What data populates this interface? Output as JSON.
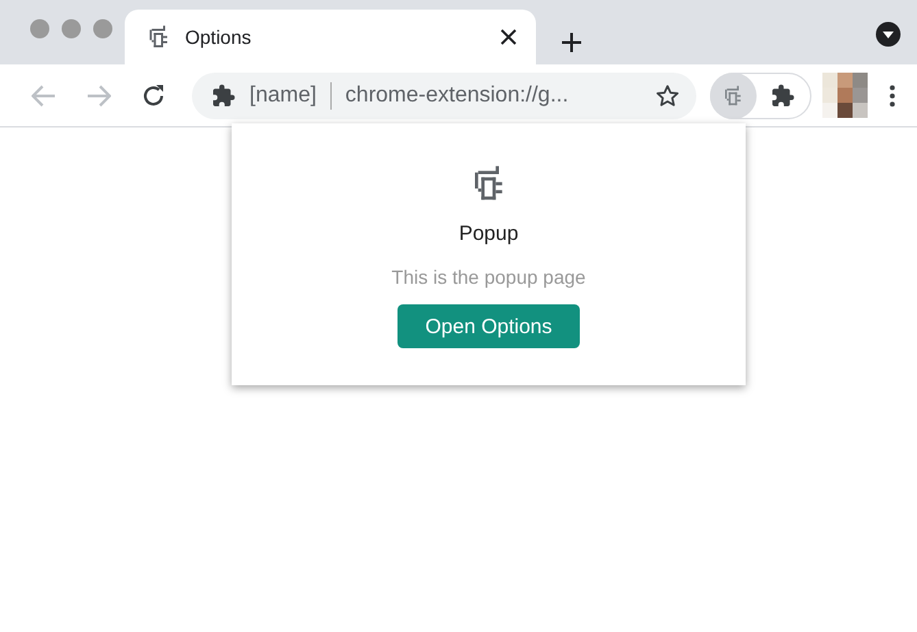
{
  "tab": {
    "title": "Options",
    "selected": true
  },
  "omnibox": {
    "site_name": "[name]",
    "url": "chrome-extension://g..."
  },
  "toolbar": {
    "extension_active": true
  },
  "popup": {
    "title": "Popup",
    "description": "This is the popup page",
    "button": "Open Options"
  }
}
